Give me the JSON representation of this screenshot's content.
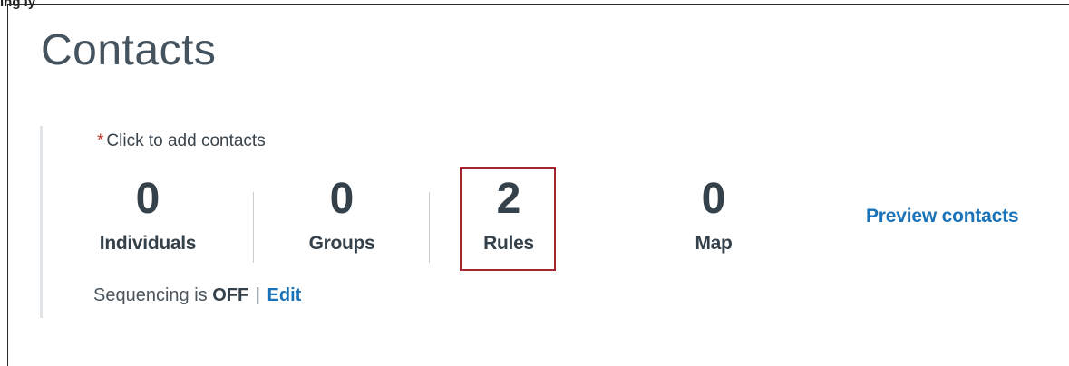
{
  "top_label": "ing ly",
  "page_title": "Contacts",
  "hint": {
    "asterisk": "*",
    "text": "Click to add contacts"
  },
  "stats": {
    "individuals": {
      "count": "0",
      "label": "Individuals"
    },
    "groups": {
      "count": "0",
      "label": "Groups"
    },
    "rules": {
      "count": "2",
      "label": "Rules"
    },
    "map": {
      "count": "0",
      "label": "Map"
    }
  },
  "preview_link": "Preview contacts",
  "sequencing": {
    "prefix": "Sequencing is",
    "state": "OFF",
    "separator": "|",
    "edit_label": "Edit"
  },
  "colors": {
    "highlight_border": "#a3262e",
    "link": "#1a73b8",
    "required_asterisk": "#c0392b"
  }
}
